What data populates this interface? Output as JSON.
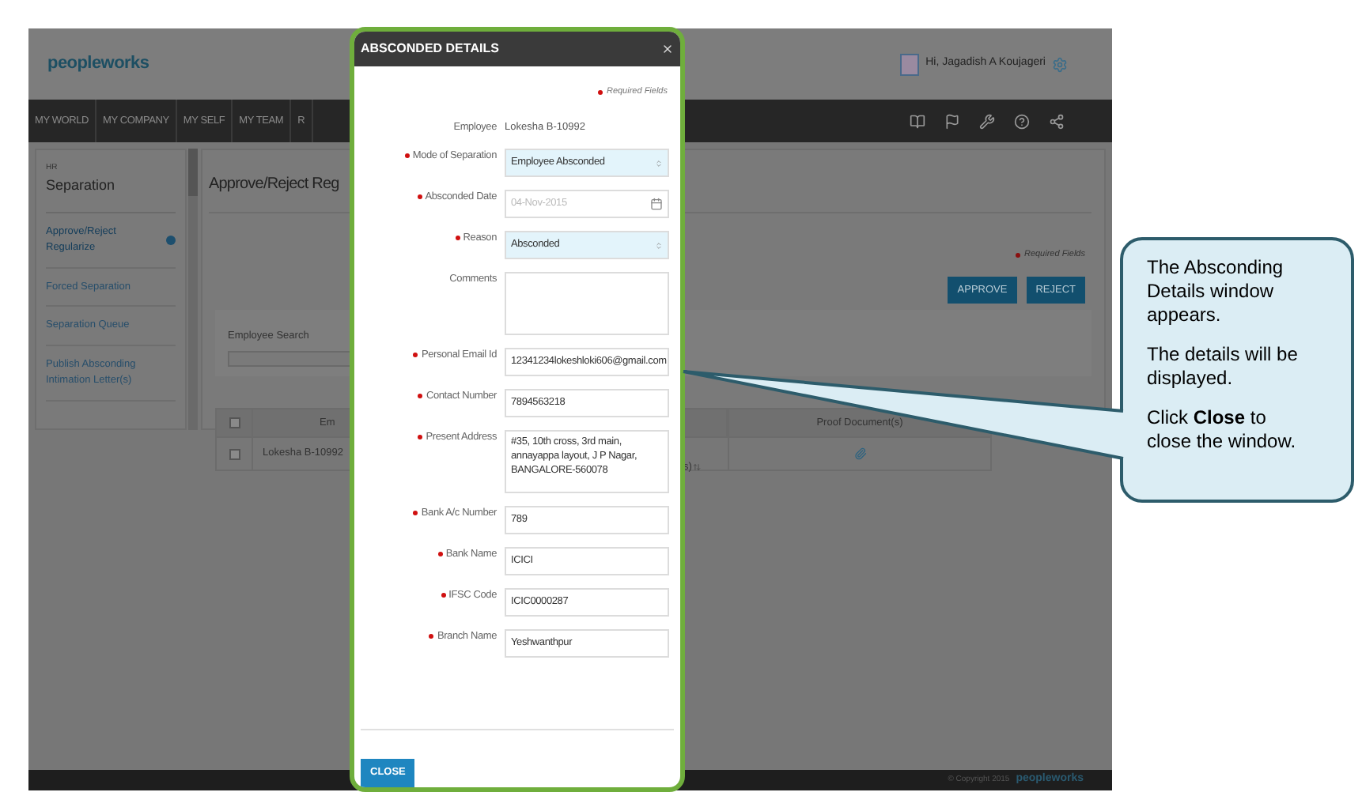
{
  "app": {
    "logo": "peopleworks",
    "user_greeting": "Hi, Jagadish A Koujageri"
  },
  "nav": [
    {
      "label": "MY WORLD"
    },
    {
      "label": "MY COMPANY"
    },
    {
      "label": "MY SELF"
    },
    {
      "label": "MY TEAM"
    },
    {
      "label": "R"
    }
  ],
  "sidebar": {
    "section": "HR",
    "title": "Separation",
    "items": [
      {
        "label": "Approve/Reject Regularize",
        "selected": true
      },
      {
        "label": "Forced Separation",
        "selected": false
      },
      {
        "label": "Separation Queue",
        "selected": false
      },
      {
        "label": "Publish Absconding Intimation Letter(s)",
        "selected": false
      }
    ]
  },
  "main": {
    "title": "Approve/Reject Reg",
    "required_note": "Required Fields",
    "buttons": [
      "APPROVE",
      "REJECT"
    ],
    "search_label": "Employee Search",
    "table": {
      "header_checked": false,
      "columns": [
        "Em",
        "s)",
        "Proof Document(s)"
      ],
      "rows": [
        {
          "checked": false,
          "column_2": "Lokesha B-10992"
        }
      ]
    }
  },
  "footer": {
    "copyright": "© Copyright 2015",
    "logo": "peopleworks"
  },
  "dialog": {
    "title": "ABSCONDED DETAILS",
    "required_note": "Required Fields",
    "close_button": "CLOSE",
    "fields": [
      {
        "kind": "static",
        "label": "Employee",
        "value": "Lokesha B-10992",
        "required": false
      },
      {
        "kind": "select",
        "label": "Mode of Separation",
        "value": "Employee Absconded",
        "required": true
      },
      {
        "kind": "date",
        "label": "Absconded Date",
        "value": "04-Nov-2015",
        "required": true,
        "disabled": true
      },
      {
        "kind": "select",
        "label": "Reason",
        "value": "Absconded",
        "required": true
      },
      {
        "kind": "textarea",
        "label": "Comments",
        "required": false
      },
      {
        "kind": "input",
        "label": "Personal Email Id",
        "value": "12341234lokeshloki606@gmail.com",
        "required": true
      },
      {
        "kind": "input",
        "label": "Contact Number",
        "value": "7894563218",
        "required": true
      },
      {
        "kind": "textarea",
        "label": "Present Address",
        "value": "#35, 10th cross, 3rd main, annayappa layout, J P Nagar, BANGALORE-560078",
        "required": true
      },
      {
        "kind": "input",
        "label": "Bank A/c Number",
        "value": "789",
        "required": true
      },
      {
        "kind": "input",
        "label": "Bank Name",
        "value": "ICICI",
        "required": true
      },
      {
        "kind": "input",
        "label": "IFSC Code",
        "value": "ICIC0000287",
        "required": true
      },
      {
        "kind": "input",
        "label": "Branch Name",
        "value": "Yeshwanthpur",
        "required": true
      }
    ]
  },
  "callout": {
    "paragraphs": [
      "The Absconding Details window appears.",
      "The details will be displayed.",
      "Click **Close** to close the window."
    ]
  }
}
